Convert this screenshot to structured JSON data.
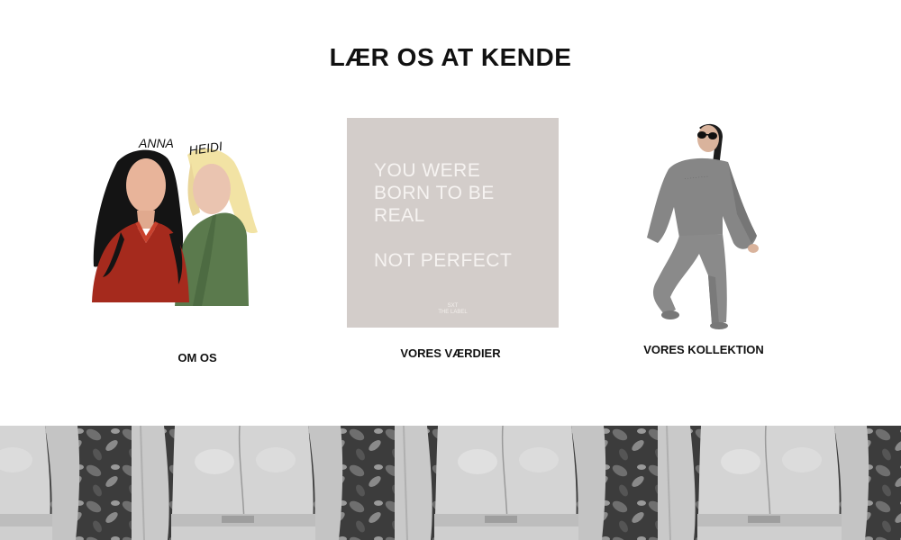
{
  "page": {
    "title": "LÆR OS AT KENDE"
  },
  "cards": [
    {
      "id": "about",
      "label": "OM OS",
      "names": [
        "ANNA",
        "HEIDI"
      ]
    },
    {
      "id": "values",
      "label": "VORES VÆRDIER",
      "quote_lines": [
        "YOU WERE",
        "BORN TO BE",
        "REAL",
        "NOT PERFECT"
      ],
      "quote_logo": [
        "SXT",
        "THE LABEL"
      ]
    },
    {
      "id": "collection",
      "label": "VORES KOLLEKTION"
    }
  ],
  "colors": {
    "background": "#ffffff",
    "quote_background": "#d3cdca",
    "quote_text": "#f6f3f1",
    "title": "#111111"
  }
}
